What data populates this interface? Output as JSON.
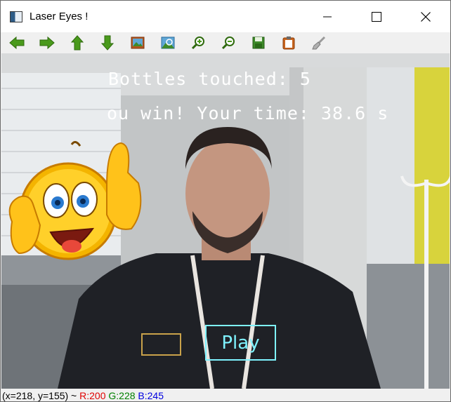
{
  "window": {
    "title": "Laser Eyes !",
    "minimize_icon": "minimize-icon",
    "maximize_icon": "maximize-icon",
    "close_icon": "close-icon"
  },
  "toolbar": {
    "tools": [
      {
        "name": "pan-left-icon"
      },
      {
        "name": "pan-right-icon"
      },
      {
        "name": "pan-up-icon"
      },
      {
        "name": "pan-down-icon"
      },
      {
        "name": "zoom-image-icon"
      },
      {
        "name": "zoom-region-icon"
      },
      {
        "name": "zoom-in-icon"
      },
      {
        "name": "zoom-out-icon"
      },
      {
        "name": "save-icon"
      },
      {
        "name": "copy-clipboard-icon"
      },
      {
        "name": "properties-brush-icon"
      }
    ]
  },
  "overlay": {
    "bottles_text": "Bottles touched: 5",
    "win_text": "ou win! Your time: 38.6 s",
    "play_label": "Play",
    "emoji": "thumbs-up-smiley-icon"
  },
  "status_bar": {
    "coords": "(x=218, y=155) ~",
    "r": "R:200",
    "g": "G:228",
    "b": "B:245",
    "colors": {
      "r": "#e00000",
      "g": "#008000",
      "b": "#0000e0"
    }
  }
}
